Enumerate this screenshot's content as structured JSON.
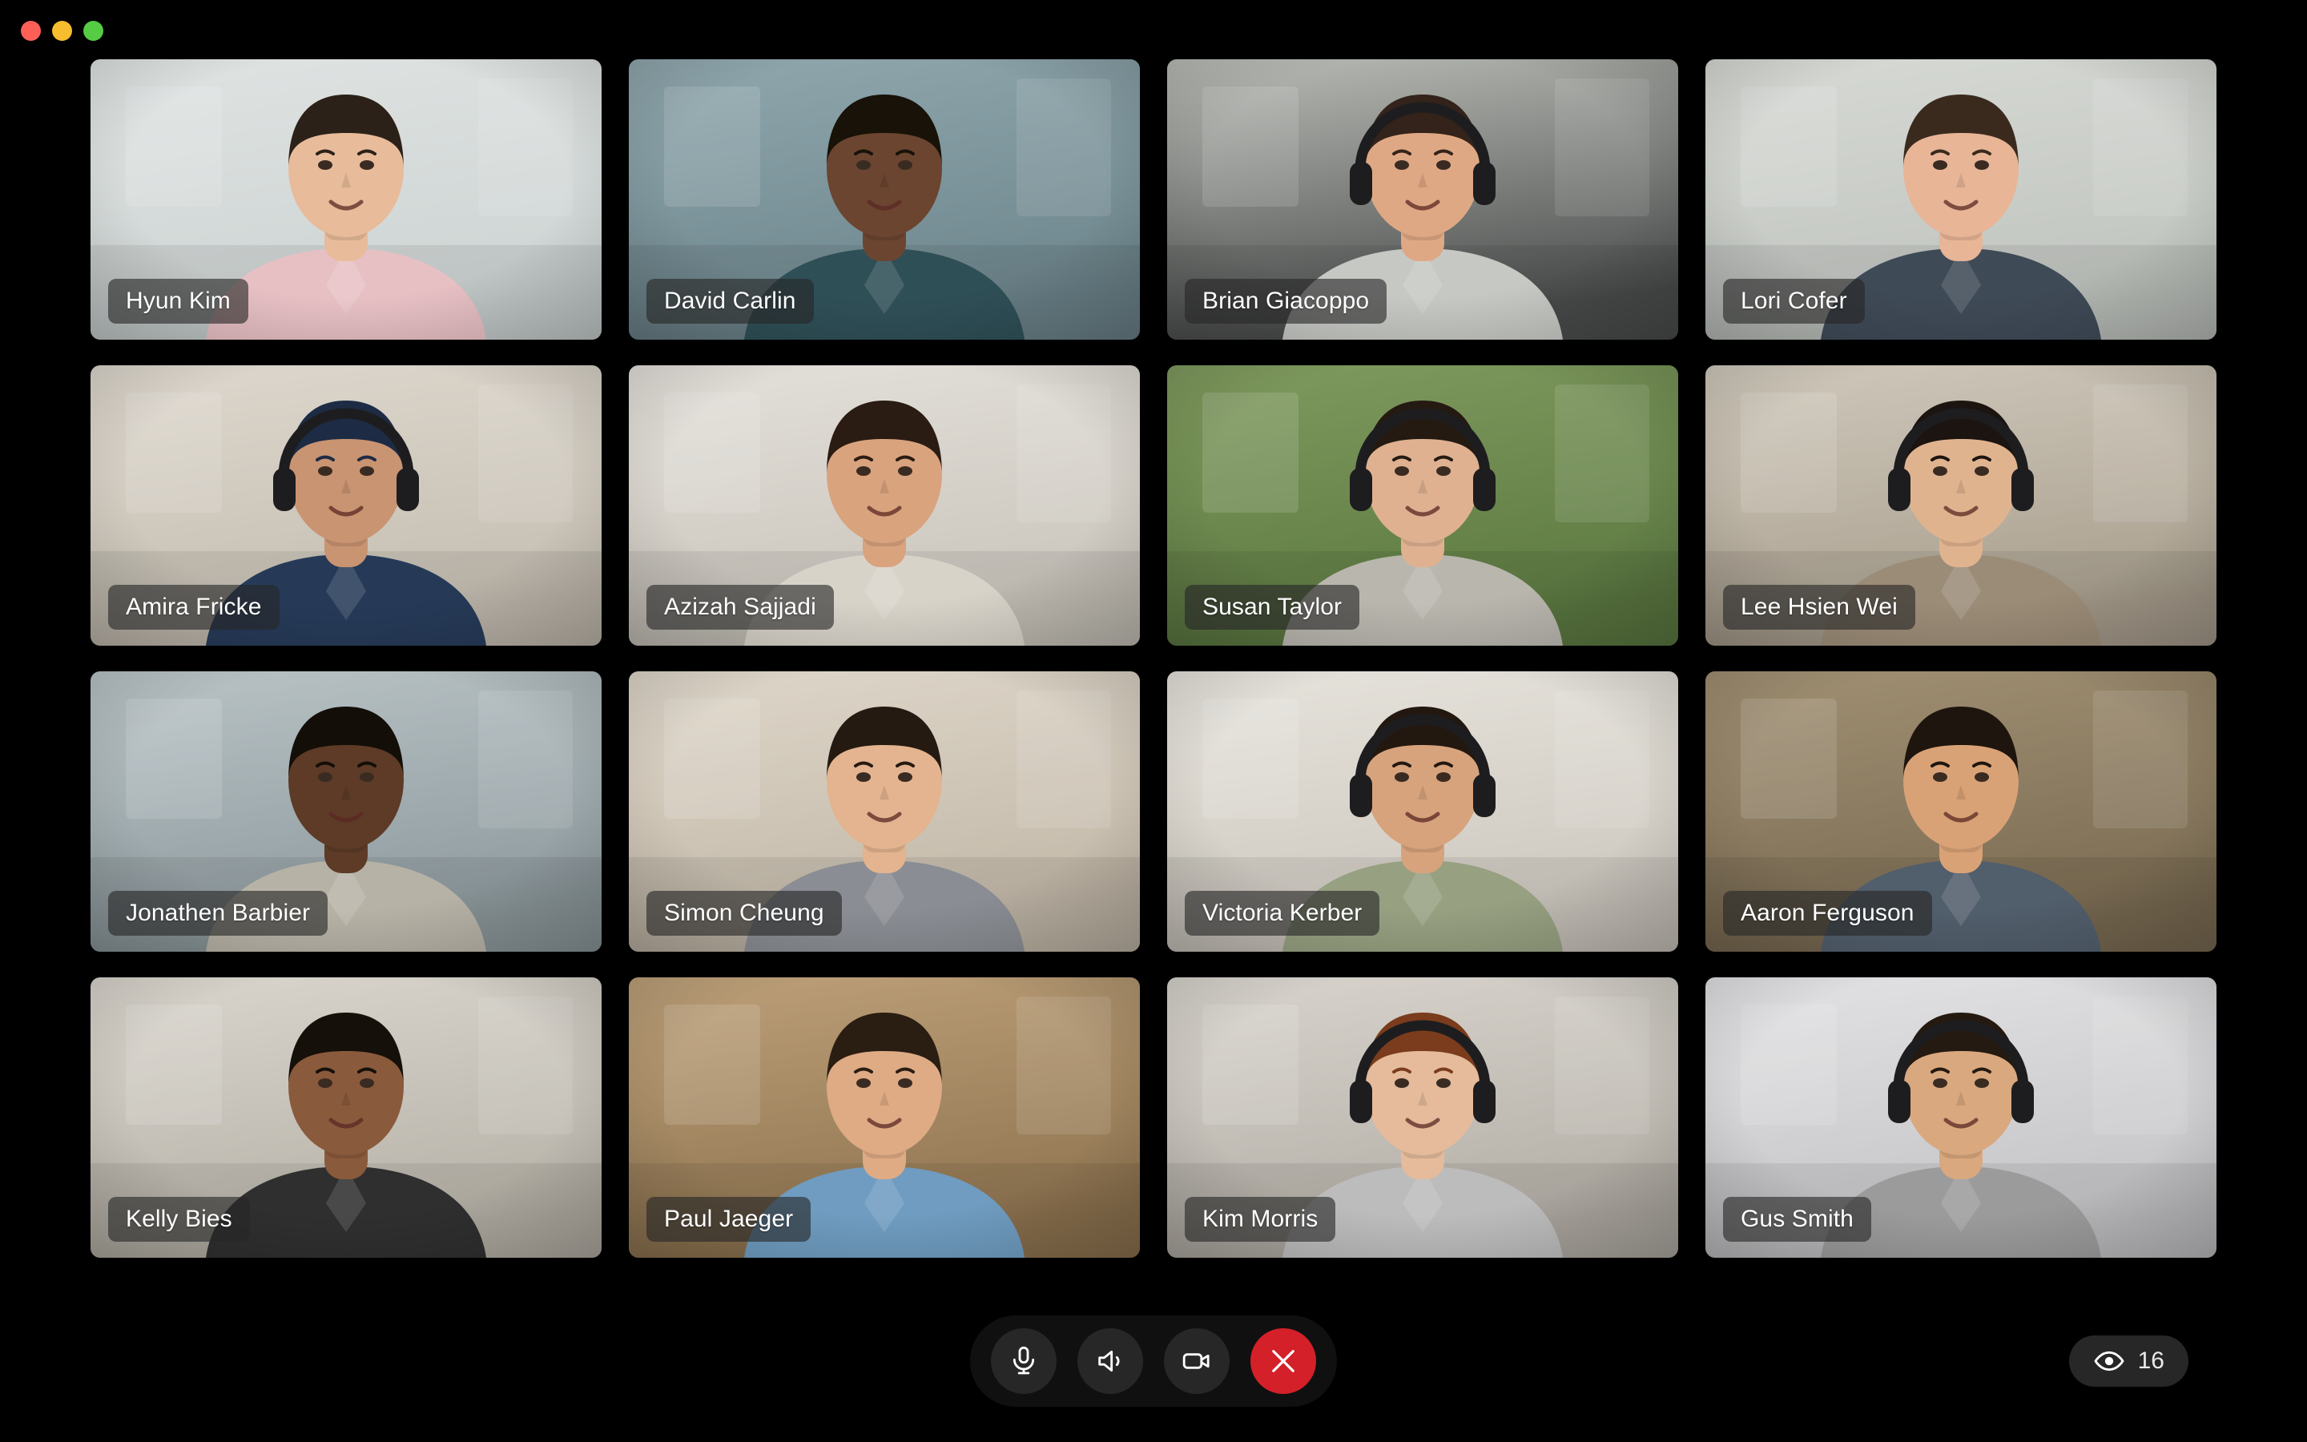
{
  "window": {
    "traffic_lights": [
      {
        "name": "close",
        "color": "#ff5f57"
      },
      {
        "name": "minimize",
        "color": "#f6be2e"
      },
      {
        "name": "zoom",
        "color": "#55cc44"
      }
    ]
  },
  "grid": {
    "columns": 4,
    "rows": 4,
    "participants": [
      {
        "name": "Hyun Kim",
        "skin": "#e8bb9a",
        "hair": "#2b2118",
        "shirt": "#e7c0c4",
        "bg_top": "#dfe3e2",
        "bg_bottom": "#cdd4d3",
        "headphones": false
      },
      {
        "name": "David Carlin",
        "skin": "#6b4530",
        "hair": "#181208",
        "shirt": "#2f4f57",
        "bg_top": "#8fa7ad",
        "bg_bottom": "#6d858c",
        "headphones": false
      },
      {
        "name": "Brian Giacoppo",
        "skin": "#dfa884",
        "hair": "#33231a",
        "shirt": "#c6c8c4",
        "bg_top": "#b9bcb6",
        "bg_bottom": "#4c4f4e",
        "headphones": true
      },
      {
        "name": "Lori Cofer",
        "skin": "#e8b597",
        "hair": "#3a2a1d",
        "shirt": "#3f4a57",
        "bg_top": "#d6d9d4",
        "bg_bottom": "#c0c4bf",
        "headphones": false
      },
      {
        "name": "Amira Fricke",
        "skin": "#c99472",
        "hair": "#1d2b44",
        "shirt": "#263a58",
        "bg_top": "#ddd7cd",
        "bg_bottom": "#c5beb2",
        "headphones": true
      },
      {
        "name": "Azizah Sajjadi",
        "skin": "#d9a37e",
        "hair": "#2a1c13",
        "shirt": "#d8d3c9",
        "bg_top": "#e3e0da",
        "bg_bottom": "#cac5bc",
        "headphones": false
      },
      {
        "name": "Susan Taylor",
        "skin": "#dfb191",
        "hair": "#241a12",
        "shirt": "#b9b6ae",
        "bg_top": "#7f9a5e",
        "bg_bottom": "#5d7a42",
        "headphones": true
      },
      {
        "name": "Lee Hsien Wei",
        "skin": "#e0b38f",
        "hair": "#1b1410",
        "shirt": "#9b8c77",
        "bg_top": "#cfc8bb",
        "bg_bottom": "#a99f8e",
        "headphones": true
      },
      {
        "name": "Jonathen Barbier",
        "skin": "#5d3b27",
        "hair": "#140e08",
        "shirt": "#b7b2a6",
        "bg_top": "#b9c3c6",
        "bg_bottom": "#8e9a9e",
        "headphones": false
      },
      {
        "name": "Simon Cheung",
        "skin": "#e3b48f",
        "hair": "#241a12",
        "shirt": "#8a8d93",
        "bg_top": "#ded6c9",
        "bg_bottom": "#c2b8a8",
        "headphones": false
      },
      {
        "name": "Victoria Kerber",
        "skin": "#d7a37c",
        "hair": "#231810",
        "shirt": "#97a081",
        "bg_top": "#e6e3dc",
        "bg_bottom": "#cdc8bf",
        "headphones": true
      },
      {
        "name": "Aaron Ferguson",
        "skin": "#d9a276",
        "hair": "#1e150e",
        "shirt": "#515e6b",
        "bg_top": "#a08f72",
        "bg_bottom": "#7b6c53",
        "headphones": false
      },
      {
        "name": "Kelly Bies",
        "skin": "#8a5a3c",
        "hair": "#16100a",
        "shirt": "#2f2f2f",
        "bg_top": "#d9d5cd",
        "bg_bottom": "#b7b2a8",
        "headphones": false
      },
      {
        "name": "Paul Jaeger",
        "skin": "#deab85",
        "hair": "#2a1d12",
        "shirt": "#6f9cc0",
        "bg_top": "#bda079",
        "bg_bottom": "#8f7450",
        "headphones": false
      },
      {
        "name": "Kim Morris",
        "skin": "#e5bb9b",
        "hair": "#7a3c1c",
        "shirt": "#bcbcbc",
        "bg_top": "#d8d4cd",
        "bg_bottom": "#b3aea6",
        "headphones": true
      },
      {
        "name": "Gus Smith",
        "skin": "#d9a87e",
        "hair": "#241a11",
        "shirt": "#9b9b9b",
        "bg_top": "#e2e2e4",
        "bg_bottom": "#c4c4c7",
        "headphones": true
      }
    ]
  },
  "controls": {
    "microphone_label": "Microphone",
    "speaker_label": "Speaker",
    "camera_label": "Camera",
    "end_call_label": "End call",
    "end_call_color": "#d42029"
  },
  "status": {
    "viewers_icon": "eye-icon",
    "viewers_count": "16"
  }
}
